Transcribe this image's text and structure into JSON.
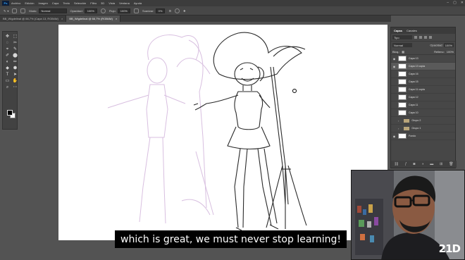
{
  "menubar": {
    "logo": "Ps",
    "items": [
      "Archivo",
      "Edición",
      "Imagen",
      "Capa",
      "Texto",
      "Selección",
      "Filtro",
      "3D",
      "Vista",
      "Ventana",
      "Ayuda"
    ]
  },
  "options": {
    "mode_label": "Modo:",
    "mode_value": "Normal",
    "opacity_label": "Opacidad:",
    "opacity_value": "100%",
    "flow_label": "Flujo:",
    "flow_value": "100%",
    "smooth_label": "Suavizar:",
    "smooth_value": "0%"
  },
  "tabs": [
    {
      "label": "BB_Wigdelinal @ 66,7% (Capa 13, RGB/8#)",
      "close": "×"
    },
    {
      "label": "BB_Wigdelinal @ 66,7% (RGB/8#)",
      "close": "×"
    }
  ],
  "tools": [
    "✥",
    "⬚",
    "◌",
    "✂",
    "⌖",
    "✎",
    "✐",
    "⬤",
    "◐",
    "✏",
    "◆",
    "⬢",
    "T",
    "➤",
    "▭",
    "✋",
    "⌕",
    "⋯"
  ],
  "layers_panel": {
    "tab_layers": "Capas",
    "tab_channels": "Canales",
    "filter_label": "Tipo",
    "blend_mode": "Normal",
    "opacity_label": "Opacidad:",
    "opacity_value": "100%",
    "lock_label": "Bloq.:",
    "fill_label": "Relleno:",
    "fill_value": "100%",
    "layers": [
      {
        "name": "Capa 13",
        "visible": true,
        "kind": "layer",
        "selected": false
      },
      {
        "name": "Capa 13 copia",
        "visible": true,
        "kind": "layer",
        "selected": true
      },
      {
        "name": "Capa 16",
        "visible": false,
        "kind": "layer",
        "selected": false
      },
      {
        "name": "Capa 15",
        "visible": false,
        "kind": "layer",
        "selected": false
      },
      {
        "name": "Capa 11 copia",
        "visible": false,
        "kind": "layer",
        "selected": false
      },
      {
        "name": "Capa 12",
        "visible": false,
        "kind": "layer",
        "selected": false
      },
      {
        "name": "Capa 11",
        "visible": false,
        "kind": "layer",
        "selected": false
      },
      {
        "name": "Capa 10",
        "visible": false,
        "kind": "layer",
        "selected": false
      },
      {
        "name": "Grupo 2",
        "visible": false,
        "kind": "group",
        "selected": false
      },
      {
        "name": "Grupo 1",
        "visible": false,
        "kind": "group",
        "selected": false
      },
      {
        "name": "Fondo",
        "visible": true,
        "kind": "layer",
        "selected": false
      }
    ],
    "footer_icons": [
      "link-icon",
      "fx-icon",
      "mask-icon",
      "adjustment-icon",
      "folder-icon",
      "new-layer-icon",
      "trash-icon"
    ]
  },
  "webcam": {
    "watermark": "21D"
  },
  "subtitle": "which is great, we must never stop learning!",
  "colors": {
    "accent": "#31a8ff",
    "workspace": "#535353",
    "panel": "#474747"
  }
}
